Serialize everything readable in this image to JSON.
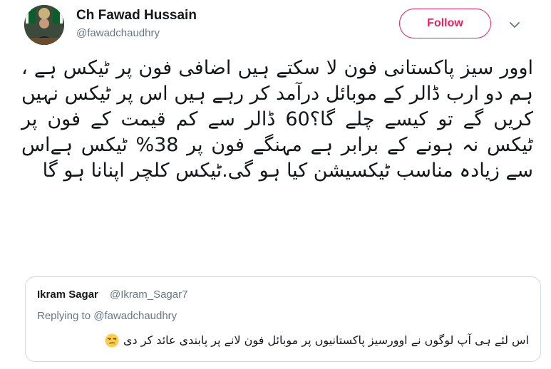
{
  "author": {
    "name": "Ch Fawad Hussain",
    "handle": "@fawadchaudhry",
    "avatar_icon": "profile-photo"
  },
  "follow_button": {
    "label": "Follow",
    "color": "#e0245e"
  },
  "more_menu_icon": "chevron-down-icon",
  "tweet_text": "اوور سیز پاکستانی فون لا سکتے ہیں اضافی فون پر ٹیکس ہے ، ہم دو ارب ڈالر کے موبائل درآمد کر رہے ہیں اس پر ٹیکس نہیں کریں گے تو کیسے چلے گا؟60 ڈالر سے کم قیمت کے فون پر ٹیکس نہ ہونے کے برابر ہے مہنگے فون پر 38% ٹیکس ہےاس سے زیادہ مناسب ٹیکسیشن کیا ہو گی.ٹیکس کلچر اپنانا ہو گا",
  "quoted_tweet": {
    "name": "Ikram Sagar",
    "handle": "@Ikram_Sagar7",
    "replying_to_label": "Replying to",
    "replying_to_handle": "@fawadchaudhry",
    "text": "اس لئے ہی آپ لوگوں نے اوورسیز پاکستانیوں پر موبائل فون لانے پر پابندی عائد کر دی",
    "emoji": "unamused-face-icon"
  },
  "colors": {
    "text": "#14171a",
    "secondary": "#657786",
    "border": "#cfd9de"
  }
}
